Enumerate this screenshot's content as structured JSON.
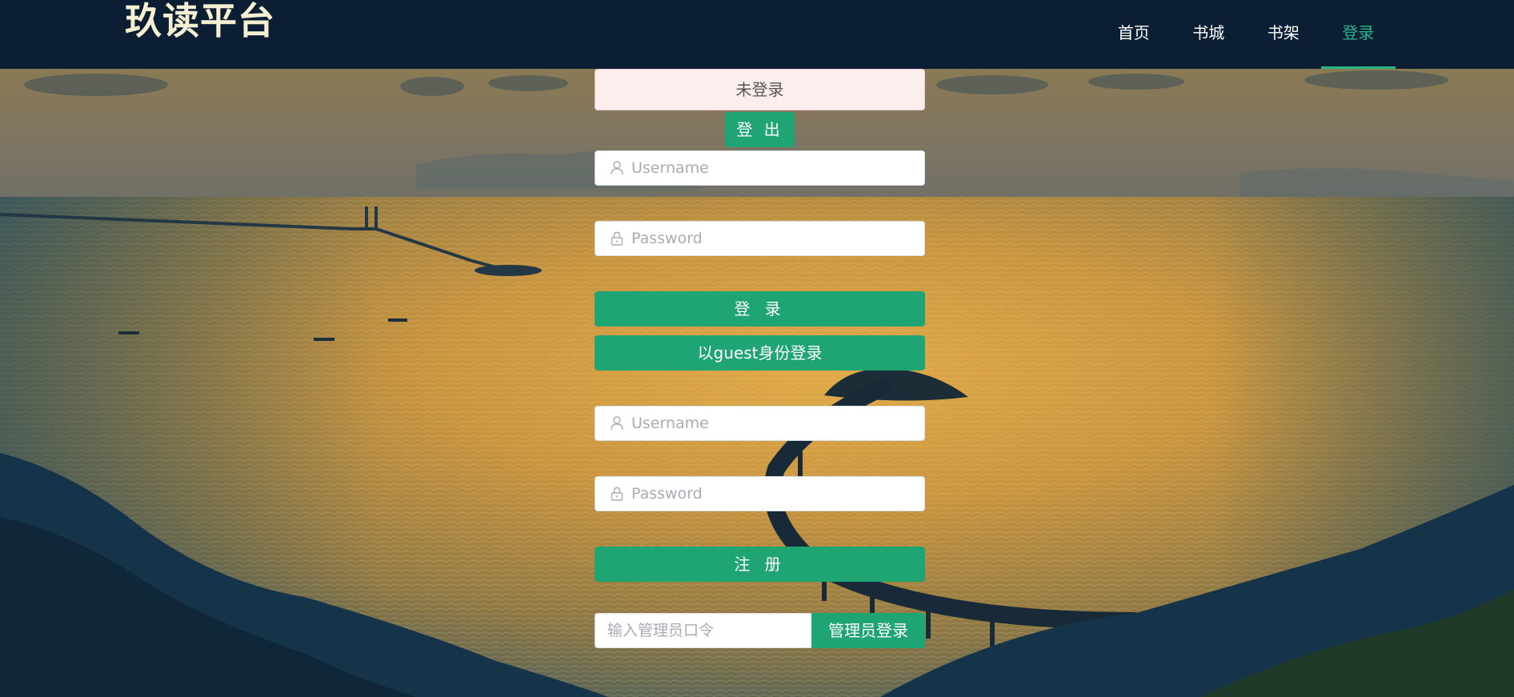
{
  "header": {
    "brand": "玖读平台",
    "nav": [
      {
        "label": "首页",
        "active": false
      },
      {
        "label": "书城",
        "active": false
      },
      {
        "label": "书架",
        "active": false
      },
      {
        "label": "登录",
        "active": true
      }
    ]
  },
  "status": {
    "text": "未登录"
  },
  "logout_label": "登 出",
  "login": {
    "username_placeholder": "Username",
    "password_placeholder": "Password",
    "submit_label": "登 录",
    "guest_label": "以guest身份登录"
  },
  "register": {
    "username_placeholder": "Username",
    "password_placeholder": "Password",
    "submit_label": "注 册"
  },
  "admin": {
    "placeholder": "输入管理员口令",
    "button_label": "管理员登录"
  },
  "colors": {
    "header_bg": "#0b1e33",
    "accent": "#1fa473",
    "nav_active": "#27b787",
    "status_bg": "#fdeeee"
  },
  "icons": {
    "user": "user-icon",
    "lock": "lock-icon"
  }
}
